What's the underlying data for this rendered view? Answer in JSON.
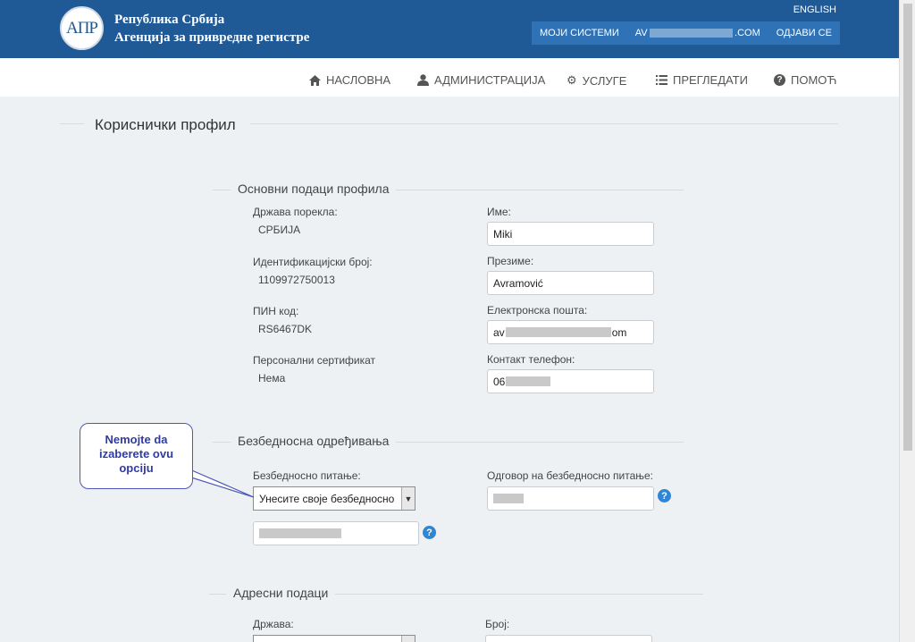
{
  "header": {
    "logo_text": "АПР",
    "brand_line1": "Република Србија",
    "brand_line2": "Агенција за привредне регистре",
    "lang_link": "ENGLISH",
    "my_systems": "МОЈИ СИСТЕМИ",
    "email_prefix": "AV",
    "email_suffix": ".COM",
    "logout": "ОДЈАВИ СЕ"
  },
  "nav": [
    {
      "label": "НАСЛОВНА",
      "icon": "home-icon"
    },
    {
      "label": "АДМИНИСТРАЦИЈА",
      "icon": "user-icon"
    },
    {
      "label": "УСЛУГЕ",
      "icon": "gear-icon"
    },
    {
      "label": "ПРЕГЛЕДАТИ",
      "icon": "list-icon"
    },
    {
      "label": "ПОМОЋ",
      "icon": "help-icon"
    }
  ],
  "page_title": "Кориснички профил",
  "basic": {
    "title": "Основни подаци профила",
    "country_label": "Држава порекла:",
    "country_value": "СРБИЈА",
    "id_label": "Идентификацијски број:",
    "id_value": "1109972750013",
    "pin_label": "ПИН код:",
    "pin_value": "RS6467DK",
    "cert_label": "Персонални сертификат",
    "cert_value": "Нема",
    "name_label": "Име:",
    "name_value": "Miki",
    "surname_label": "Презиме:",
    "surname_value": "Avramović",
    "email_label": "Електронска пошта:",
    "email_prefix": "av",
    "email_suffix": "om",
    "phone_label": "Контакт телефон:",
    "phone_prefix": "06"
  },
  "security": {
    "title": "Безбедносна одређивања",
    "question_label": "Безбедносно питање:",
    "question_selected": "Унесите своје безбедносно",
    "answer_label": "Одговор на безбедносно питање:"
  },
  "address": {
    "title": "Адресни подаци",
    "country_label": "Држава:",
    "number_label": "Број:"
  },
  "callout": {
    "line1": "Nemojte da",
    "line2": "izaberete ovu",
    "line3": "opciju",
    "border_color": "#4b5ab8",
    "text_color": "#2f3ba6"
  },
  "colors": {
    "header_bg": "#1f5a97",
    "userbox_bg": "#2f72b6",
    "help_blue": "#2f86d4"
  }
}
